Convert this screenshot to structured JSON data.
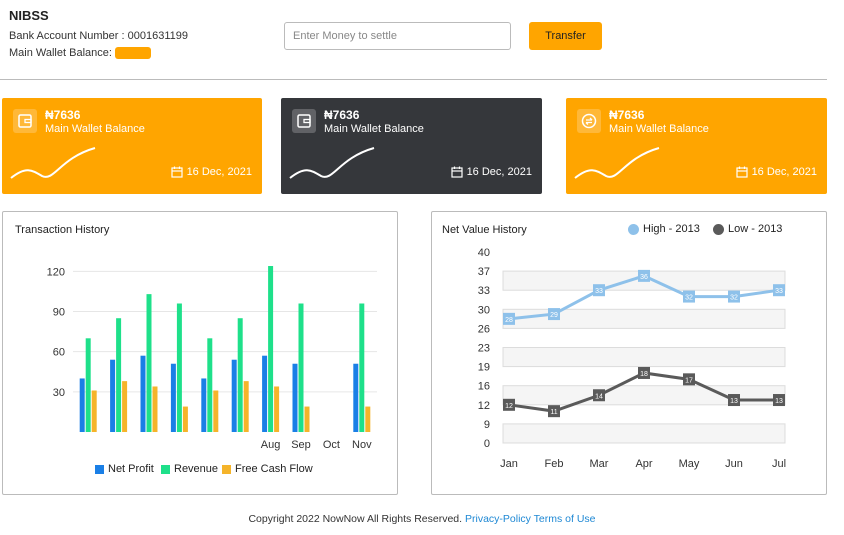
{
  "header": {
    "brand": "NIBSS",
    "bank_account_label": "Bank Account Number : 0001631199",
    "wallet_balance_label": "Main Wallet Balance:",
    "settle_placeholder": "Enter Money to settle",
    "transfer_label": "Transfer"
  },
  "cards": [
    {
      "amount": "₦7636",
      "label": "Main Wallet Balance",
      "date": "16 Dec, 2021",
      "bg": "#FFA500",
      "icon": "wallet-icon"
    },
    {
      "amount": "₦7636",
      "label": "Main Wallet Balance",
      "date": "16 Dec, 2021",
      "bg": "#35373b",
      "icon": "wallet-icon"
    },
    {
      "amount": "₦7636",
      "label": "Main Wallet Balance",
      "date": "16 Dec, 2021",
      "bg": "#FFA500",
      "icon": "exchange-icon"
    }
  ],
  "colors": {
    "accent": "#FFA500",
    "dark_card": "#35373b",
    "net_profit": "#1a7fe6",
    "revenue": "#1ee08a",
    "free_cash_flow": "#f5b42a",
    "high_series": "#8ec1ea",
    "low_series": "#5a5a5a"
  },
  "chart_data": [
    {
      "type": "bar",
      "title": "Transaction History",
      "categories": [
        "",
        "",
        "",
        "",
        "",
        "",
        "Aug",
        "Sep",
        "Oct",
        "Nov"
      ],
      "ylim": [
        0,
        130
      ],
      "yticks": [
        30,
        60,
        90,
        120
      ],
      "grid": true,
      "legend_position": "bottom",
      "series": [
        {
          "name": "Net Profit",
          "values": [
            40,
            54,
            57,
            51,
            40,
            54,
            57,
            51,
            null,
            51
          ]
        },
        {
          "name": "Revenue",
          "values": [
            70,
            85,
            103,
            96,
            70,
            85,
            124,
            96,
            null,
            96
          ]
        },
        {
          "name": "Free Cash Flow",
          "values": [
            31,
            38,
            34,
            19,
            31,
            38,
            34,
            19,
            null,
            19
          ]
        }
      ]
    },
    {
      "type": "line",
      "title": "Net Value History",
      "x": [
        "Jan",
        "Feb",
        "Mar",
        "Apr",
        "May",
        "Jun",
        "Jul"
      ],
      "yticks": [
        0,
        9,
        12,
        16,
        19,
        23,
        26,
        30,
        33,
        37,
        40
      ],
      "ylim": [
        0,
        40
      ],
      "legend_position": "top-right",
      "series": [
        {
          "name": "High - 2013",
          "values": [
            28,
            29,
            33,
            36,
            32,
            32,
            33
          ]
        },
        {
          "name": "Low - 2013",
          "values": [
            12,
            11,
            14,
            18,
            17,
            13,
            13
          ]
        }
      ]
    }
  ],
  "footer": {
    "copyright": "Copyright 2022 NowNow All Rights Reserved.",
    "privacy": "Privacy-Policy",
    "terms": "Terms of Use"
  }
}
